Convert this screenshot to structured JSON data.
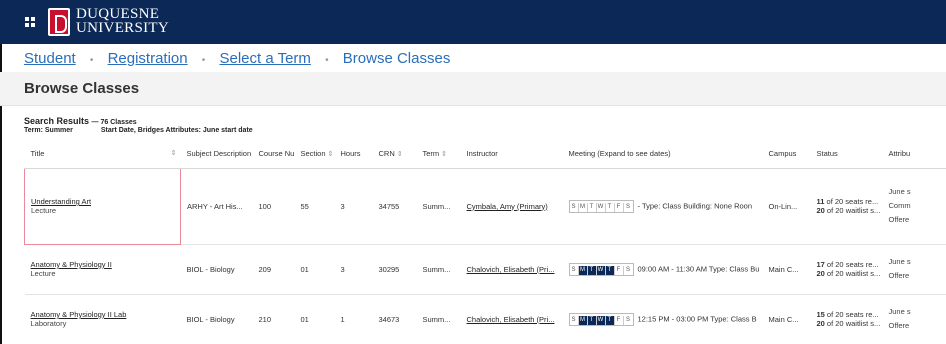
{
  "brand": {
    "line1": "DUQUESNE",
    "line2": "UNIVERSITY"
  },
  "breadcrumb": {
    "student": "Student",
    "registration": "Registration",
    "select_term": "Select a Term",
    "current": "Browse Classes",
    "separator": "•"
  },
  "page_title": "Browse Classes",
  "results": {
    "label": "Search Results",
    "count": "— 76 Classes",
    "term": "Term: Summer",
    "filters": "Start Date, Bridges Attributes: June start date"
  },
  "columns": {
    "title": "Title",
    "subject": "Subject Description",
    "course": "Course Nu",
    "section": "Section",
    "hours": "Hours",
    "crn": "CRN",
    "term": "Term",
    "instructor": "Instructor",
    "meeting": "Meeting (Expand to see dates)",
    "campus": "Campus",
    "status": "Status",
    "attributes": "Attribu"
  },
  "day_letters": [
    "S",
    "M",
    "T",
    "W",
    "T",
    "F",
    "S"
  ],
  "rows": [
    {
      "title": "Understanding Art",
      "type": "Lecture",
      "subject": "ARHY - Art His...",
      "course": "100",
      "section": "55",
      "hours": "3",
      "crn": "34755",
      "term": "Summ...",
      "instructor": "Cymbala, Amy (Primary)",
      "active_days": [],
      "meeting": "- Type: Class  Building: None  Roon",
      "campus": "On-Lin...",
      "seats_num": "11",
      "seats_text": " of 20 seats re...",
      "wait_num": "20",
      "wait_text": " of 20 waitlist s...",
      "attr": [
        "June s",
        "Comm",
        "Offere"
      ]
    },
    {
      "title": "Anatomy & Physiology II",
      "type": "Lecture",
      "subject": "BIOL - Biology",
      "course": "209",
      "section": "01",
      "hours": "3",
      "crn": "30295",
      "term": "Summ...",
      "instructor": "Chalovich, Elisabeth (Pri...",
      "active_days": [
        1,
        2,
        3,
        4
      ],
      "meeting": "09:00 AM - 11:30 AM  Type: Class  Bu",
      "campus": "Main C...",
      "seats_num": "17",
      "seats_text": " of 20 seats re...",
      "wait_num": "20",
      "wait_text": " of 20 waitlist s...",
      "attr": [
        "June s",
        "Offere"
      ]
    },
    {
      "title": "Anatomy & Physiology II Lab",
      "type": "Laboratory",
      "subject": "BIOL - Biology",
      "course": "210",
      "section": "01",
      "hours": "1",
      "crn": "34673",
      "term": "Summ...",
      "instructor": "Chalovich, Elisabeth (Pri...",
      "active_days": [
        1,
        2,
        3,
        4
      ],
      "meeting": "12:15 PM - 03:00 PM  Type: Class  B",
      "campus": "Main C...",
      "seats_num": "15",
      "seats_text": " of 20 seats re...",
      "wait_num": "20",
      "wait_text": " of 20 waitlist s...",
      "attr": [
        "June s",
        "Offere"
      ]
    }
  ]
}
